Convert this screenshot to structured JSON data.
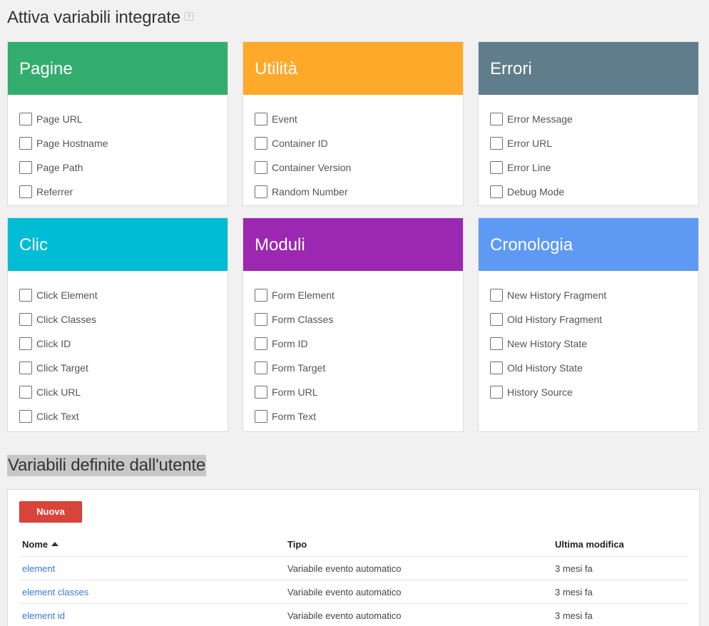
{
  "builtin": {
    "title": "Attiva variabili integrate",
    "help": "?",
    "cards": [
      {
        "title": "Pagine",
        "color": "#33ad6e",
        "items": [
          "Page URL",
          "Page Hostname",
          "Page Path",
          "Referrer"
        ]
      },
      {
        "title": "Utilità",
        "color": "#ffa92a",
        "items": [
          "Event",
          "Container ID",
          "Container Version",
          "Random Number"
        ]
      },
      {
        "title": "Errori",
        "color": "#607d8b",
        "items": [
          "Error Message",
          "Error URL",
          "Error Line",
          "Debug Mode"
        ]
      },
      {
        "title": "Clic",
        "color": "#00bcd4",
        "items": [
          "Click Element",
          "Click Classes",
          "Click ID",
          "Click Target",
          "Click URL",
          "Click Text"
        ]
      },
      {
        "title": "Moduli",
        "color": "#9c27b0",
        "items": [
          "Form Element",
          "Form Classes",
          "Form ID",
          "Form Target",
          "Form URL",
          "Form Text"
        ]
      },
      {
        "title": "Cronologia",
        "color": "#5e9af3",
        "items": [
          "New History Fragment",
          "Old History Fragment",
          "New History State",
          "Old History State",
          "History Source"
        ]
      }
    ]
  },
  "user": {
    "title": "Variabili definite dall'utente",
    "new_button": "Nuova",
    "columns": [
      "Nome",
      "Tipo",
      "Ultima modifica"
    ],
    "rows": [
      {
        "name": "element",
        "type": "Variabile evento automatico",
        "modified": "3 mesi fa"
      },
      {
        "name": "element classes",
        "type": "Variabile evento automatico",
        "modified": "3 mesi fa"
      },
      {
        "name": "element id",
        "type": "Variabile evento automatico",
        "modified": "3 mesi fa"
      }
    ]
  }
}
